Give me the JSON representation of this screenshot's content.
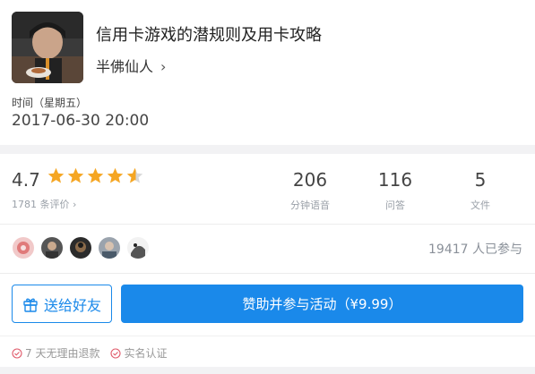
{
  "course": {
    "title": "信用卡游戏的潜规则及用卡攻略",
    "author": "半佛仙人",
    "time_label": "时间（星期五）",
    "time_value": "2017-06-30 20:00"
  },
  "rating": {
    "score": "4.7",
    "stars": 4.7,
    "review_count": "1781 条评价 ›"
  },
  "stats": [
    {
      "value": "206",
      "label": "分钟语音"
    },
    {
      "value": "116",
      "label": "问答"
    },
    {
      "value": "5",
      "label": "文件"
    }
  ],
  "participants": {
    "count_text": "19417 人已参与"
  },
  "actions": {
    "gift_label": "送给好友",
    "sponsor_label": "赞助并参与活动（¥9.99）"
  },
  "badges": [
    {
      "label": "7 天无理由退款"
    },
    {
      "label": "实名认证"
    }
  ],
  "colors": {
    "accent": "#1a89ea",
    "star": "#f5a623",
    "muted": "#9aa0a8"
  },
  "icons": {
    "cover": "author-photo",
    "author_chevron": "chevron-right-icon",
    "gift": "gift-icon",
    "badge": "check-circle-icon"
  }
}
